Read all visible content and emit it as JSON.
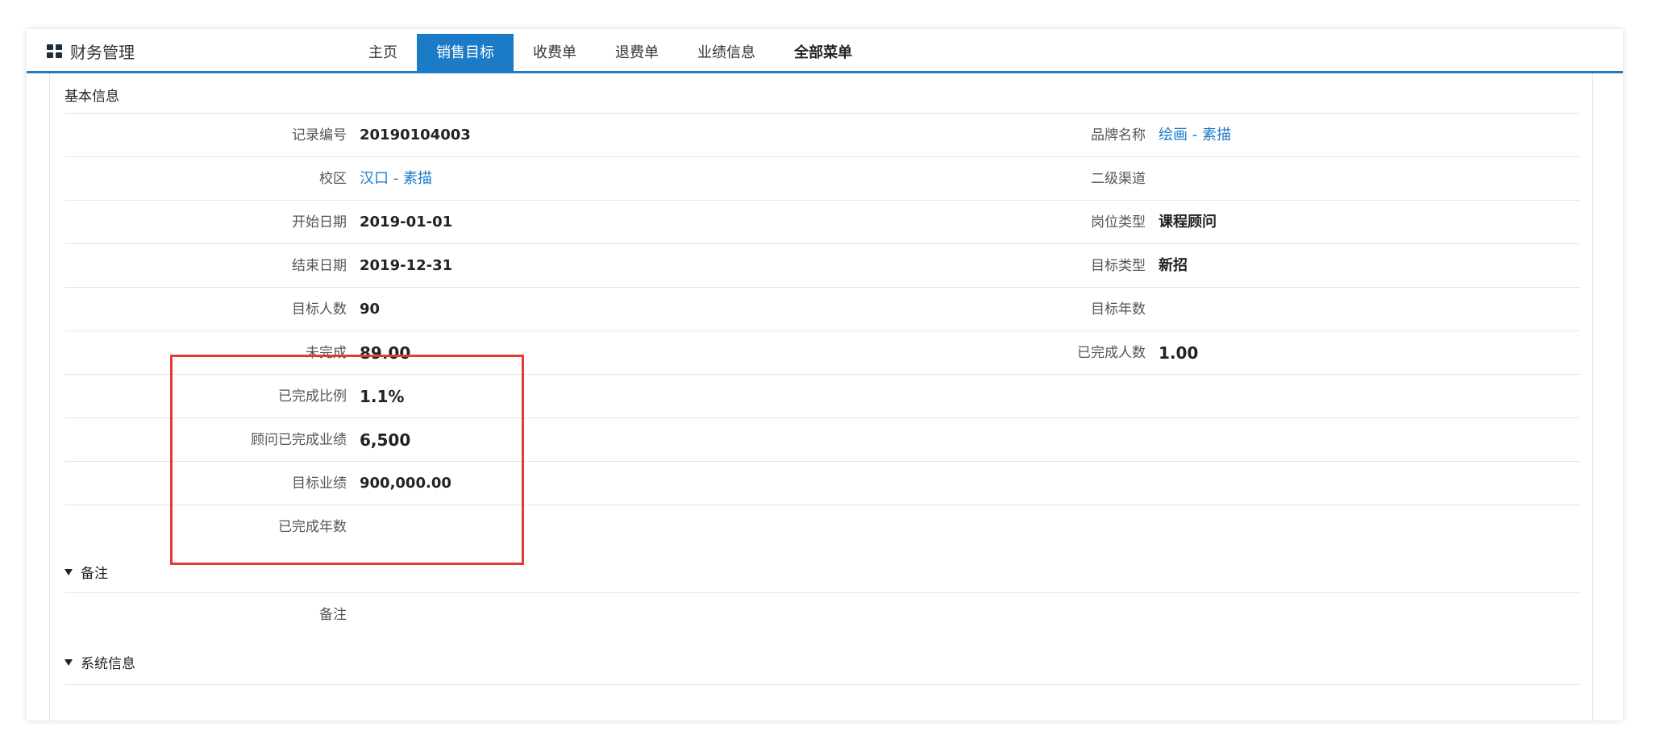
{
  "header": {
    "brand_icon": "grid-icon",
    "brand_title": "财务管理",
    "accent_color": "#1c7bc7",
    "tabs": [
      {
        "label": "主页",
        "active": false
      },
      {
        "label": "销售目标",
        "active": true
      },
      {
        "label": "收费单",
        "active": false
      },
      {
        "label": "退费单",
        "active": false
      },
      {
        "label": "业绩信息",
        "active": false
      },
      {
        "label": "全部菜单",
        "active": false
      }
    ]
  },
  "basic_info": {
    "title": "基本信息",
    "rows": [
      {
        "left_label": "记录编号",
        "left_value": "20190104003",
        "right_label": "品牌名称",
        "right_value": "绘画 - 素描"
      },
      {
        "left_label": "校区",
        "left_value": "汉口 - 素描",
        "right_label": "二级渠道",
        "right_value": ""
      },
      {
        "left_label": "开始日期",
        "left_value": "2019-01-01",
        "right_label": "岗位类型",
        "right_value": "课程顾问"
      },
      {
        "left_label": "结束日期",
        "left_value": "2019-12-31",
        "right_label": "目标类型",
        "right_value": "新招"
      },
      {
        "left_label": "目标人数",
        "left_value": "90",
        "right_label": "目标年数",
        "right_value": ""
      },
      {
        "left_label": "未完成",
        "left_value": "89.00",
        "right_label": "已完成人数",
        "right_value": "1.00"
      },
      {
        "left_label": "已完成比例",
        "left_value": "1.1%"
      },
      {
        "left_label": "顾问已完成业绩",
        "left_value": "6,500"
      },
      {
        "left_label": "目标业绩",
        "left_value": "900,000.00"
      },
      {
        "left_label": "已完成年数",
        "left_value": ""
      }
    ]
  },
  "remarks": {
    "title": "备注",
    "label": "备注",
    "value": ""
  },
  "system_info": {
    "title": "系统信息"
  },
  "highlight_color": "#e53935"
}
